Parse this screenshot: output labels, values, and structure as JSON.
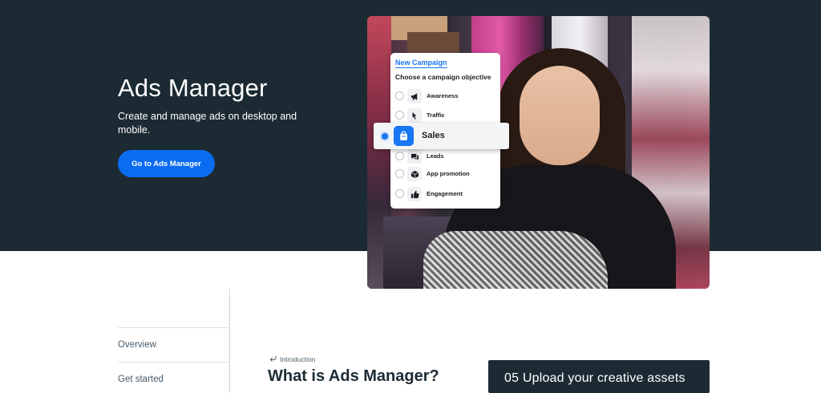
{
  "hero": {
    "title": "Ads Manager",
    "subtitle": "Create and manage ads on desktop and mobile.",
    "cta_label": "Go to Ads Manager"
  },
  "campaign_card": {
    "title": "New Campaign",
    "subtitle": "Choose a campaign objective",
    "options": [
      {
        "label": "Awareness",
        "icon": "megaphone-icon",
        "selected": false
      },
      {
        "label": "Traffic",
        "icon": "cursor-icon",
        "selected": false
      },
      {
        "label": "Sales",
        "icon": "shopping-bag-icon",
        "selected": true
      },
      {
        "label": "Leads",
        "icon": "chat-bubbles-icon",
        "selected": false
      },
      {
        "label": "App promotion",
        "icon": "box-icon",
        "selected": false
      },
      {
        "label": "Engagement",
        "icon": "thumbs-up-icon",
        "selected": false
      }
    ]
  },
  "side_nav": {
    "items": [
      {
        "label": "Overview"
      },
      {
        "label": "Get started"
      }
    ]
  },
  "main": {
    "eyebrow": "Introduction",
    "title": "What is Ads Manager?"
  },
  "steps_card": {
    "label": "05 Upload your creative assets"
  },
  "colors": {
    "hero_bg": "#1c2b33",
    "primary_button": "#0a6cf0",
    "accent": "#1877f2"
  }
}
